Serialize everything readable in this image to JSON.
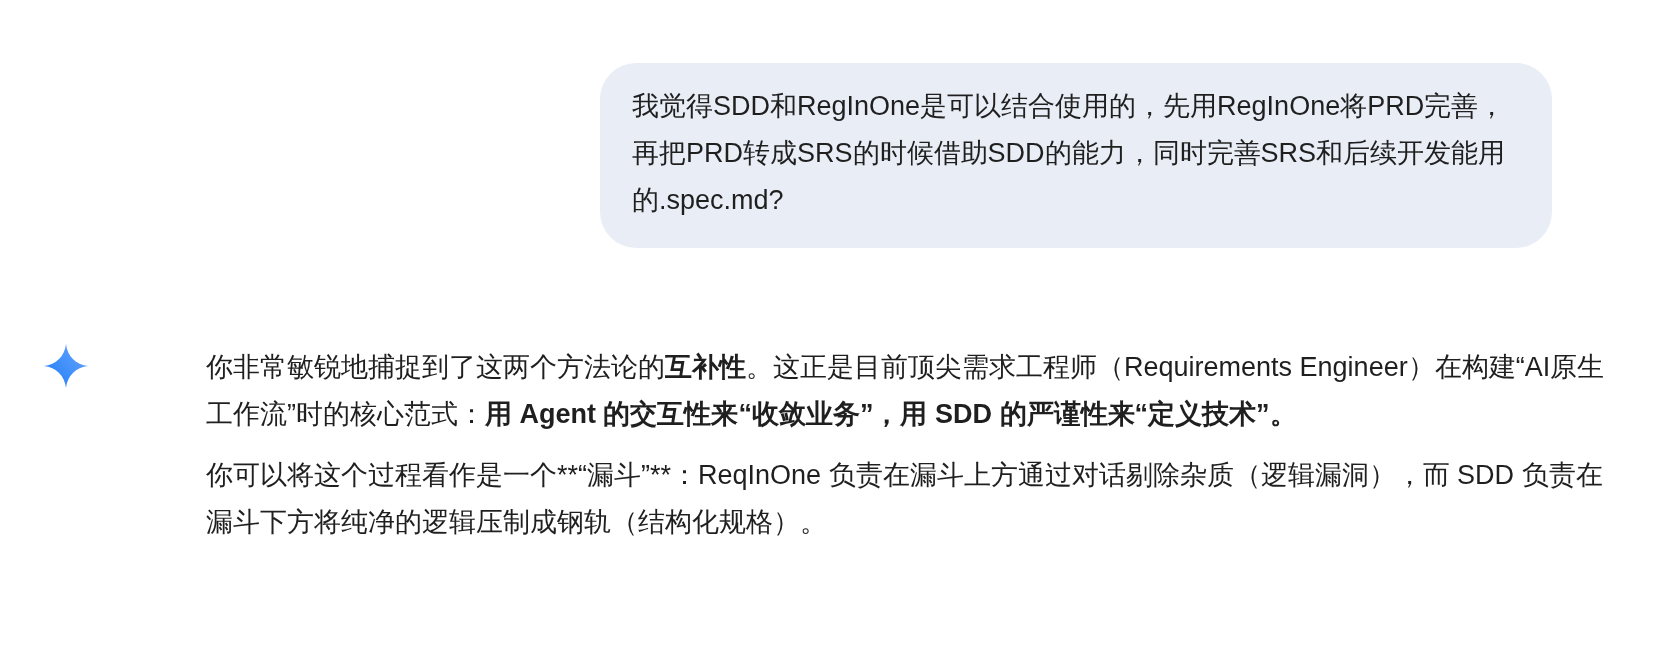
{
  "user_message": {
    "text": "我觉得SDD和RegInOne是可以结合使用的，先用RegInOne将PRD完善，再把PRD转成SRS的时候借助SDD的能力，同时完善SRS和后续开发能用的.spec.md?"
  },
  "reply": {
    "paragraphs": [
      {
        "kind": "formatted",
        "text": "你非常敏锐地捕捉到了这两个方法论的**互补性**。这正是目前顶尖需求工程师（Requirements Engineer）在构建“AI原生工作流”时的核心范式：**用 Agent 的交互性来“收敛业务”，用 SDD 的严谨性来“定义技术”。**"
      },
      {
        "kind": "plain",
        "text": "你可以将这个过程看作是一个**“漏斗”**：ReqInOne 负责在漏斗上方通过对话剔除杂质（逻辑漏洞），而 SDD 负责在漏斗下方将纯净的逻辑压制成钢轨（结构化规格）。"
      }
    ]
  }
}
